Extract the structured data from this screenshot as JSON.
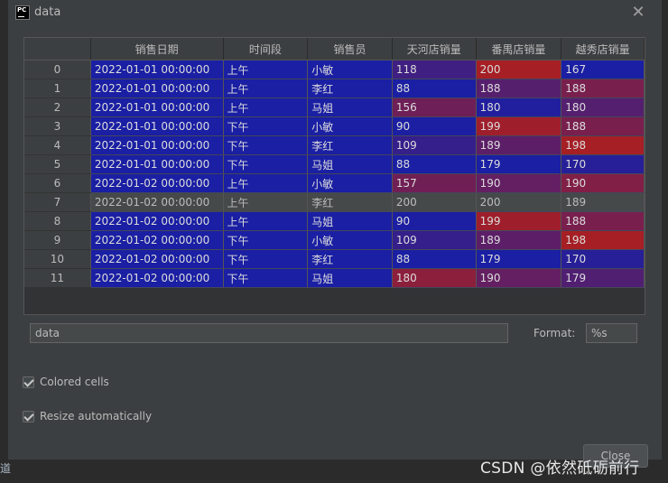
{
  "window": {
    "title": "data",
    "icon_text": "PC"
  },
  "table": {
    "columns": [
      "",
      "销售日期",
      "时间段",
      "销售员",
      "天河店销量",
      "番禺店销量",
      "越秀店销量"
    ],
    "rows": [
      {
        "idx": "0",
        "date": "2022-01-01 00:00:00",
        "period": "上午",
        "seller": "小敏",
        "th": "118",
        "py": "200",
        "yx": "167"
      },
      {
        "idx": "1",
        "date": "2022-01-01 00:00:00",
        "period": "上午",
        "seller": "李红",
        "th": "88",
        "py": "188",
        "yx": "188"
      },
      {
        "idx": "2",
        "date": "2022-01-01 00:00:00",
        "period": "上午",
        "seller": "马姐",
        "th": "156",
        "py": "180",
        "yx": "180"
      },
      {
        "idx": "3",
        "date": "2022-01-01 00:00:00",
        "period": "下午",
        "seller": "小敏",
        "th": "90",
        "py": "199",
        "yx": "188"
      },
      {
        "idx": "4",
        "date": "2022-01-01 00:00:00",
        "period": "下午",
        "seller": "李红",
        "th": "109",
        "py": "189",
        "yx": "198"
      },
      {
        "idx": "5",
        "date": "2022-01-01 00:00:00",
        "period": "下午",
        "seller": "马姐",
        "th": "88",
        "py": "179",
        "yx": "170"
      },
      {
        "idx": "6",
        "date": "2022-01-02 00:00:00",
        "period": "上午",
        "seller": "小敏",
        "th": "157",
        "py": "190",
        "yx": "190"
      },
      {
        "idx": "7",
        "date": "2022-01-02 00:00:00",
        "period": "上午",
        "seller": "李红",
        "th": "200",
        "py": "200",
        "yx": "189"
      },
      {
        "idx": "8",
        "date": "2022-01-02 00:00:00",
        "period": "上午",
        "seller": "马姐",
        "th": "90",
        "py": "199",
        "yx": "188"
      },
      {
        "idx": "9",
        "date": "2022-01-02 00:00:00",
        "period": "下午",
        "seller": "小敏",
        "th": "109",
        "py": "189",
        "yx": "198"
      },
      {
        "idx": "10",
        "date": "2022-01-02 00:00:00",
        "period": "下午",
        "seller": "李红",
        "th": "88",
        "py": "179",
        "yx": "170"
      },
      {
        "idx": "11",
        "date": "2022-01-02 00:00:00",
        "period": "下午",
        "seller": "马姐",
        "th": "180",
        "py": "190",
        "yx": "179"
      }
    ],
    "selected_row": 7,
    "colors": {
      "low": "#1a1fa3",
      "high": "#a51f25",
      "index_bg": "#3c3f41",
      "selected_bg": "#45494a"
    }
  },
  "expression": {
    "value": "data"
  },
  "format": {
    "label": "Format:",
    "value": "%s"
  },
  "options": {
    "colored_cells": {
      "label": "Colored cells",
      "checked": true
    },
    "resize_auto": {
      "label": "Resize automatically",
      "checked": true
    }
  },
  "buttons": {
    "close": "Close"
  },
  "watermark": "CSDN @依然砥砺前行",
  "left_edge_text": "道"
}
